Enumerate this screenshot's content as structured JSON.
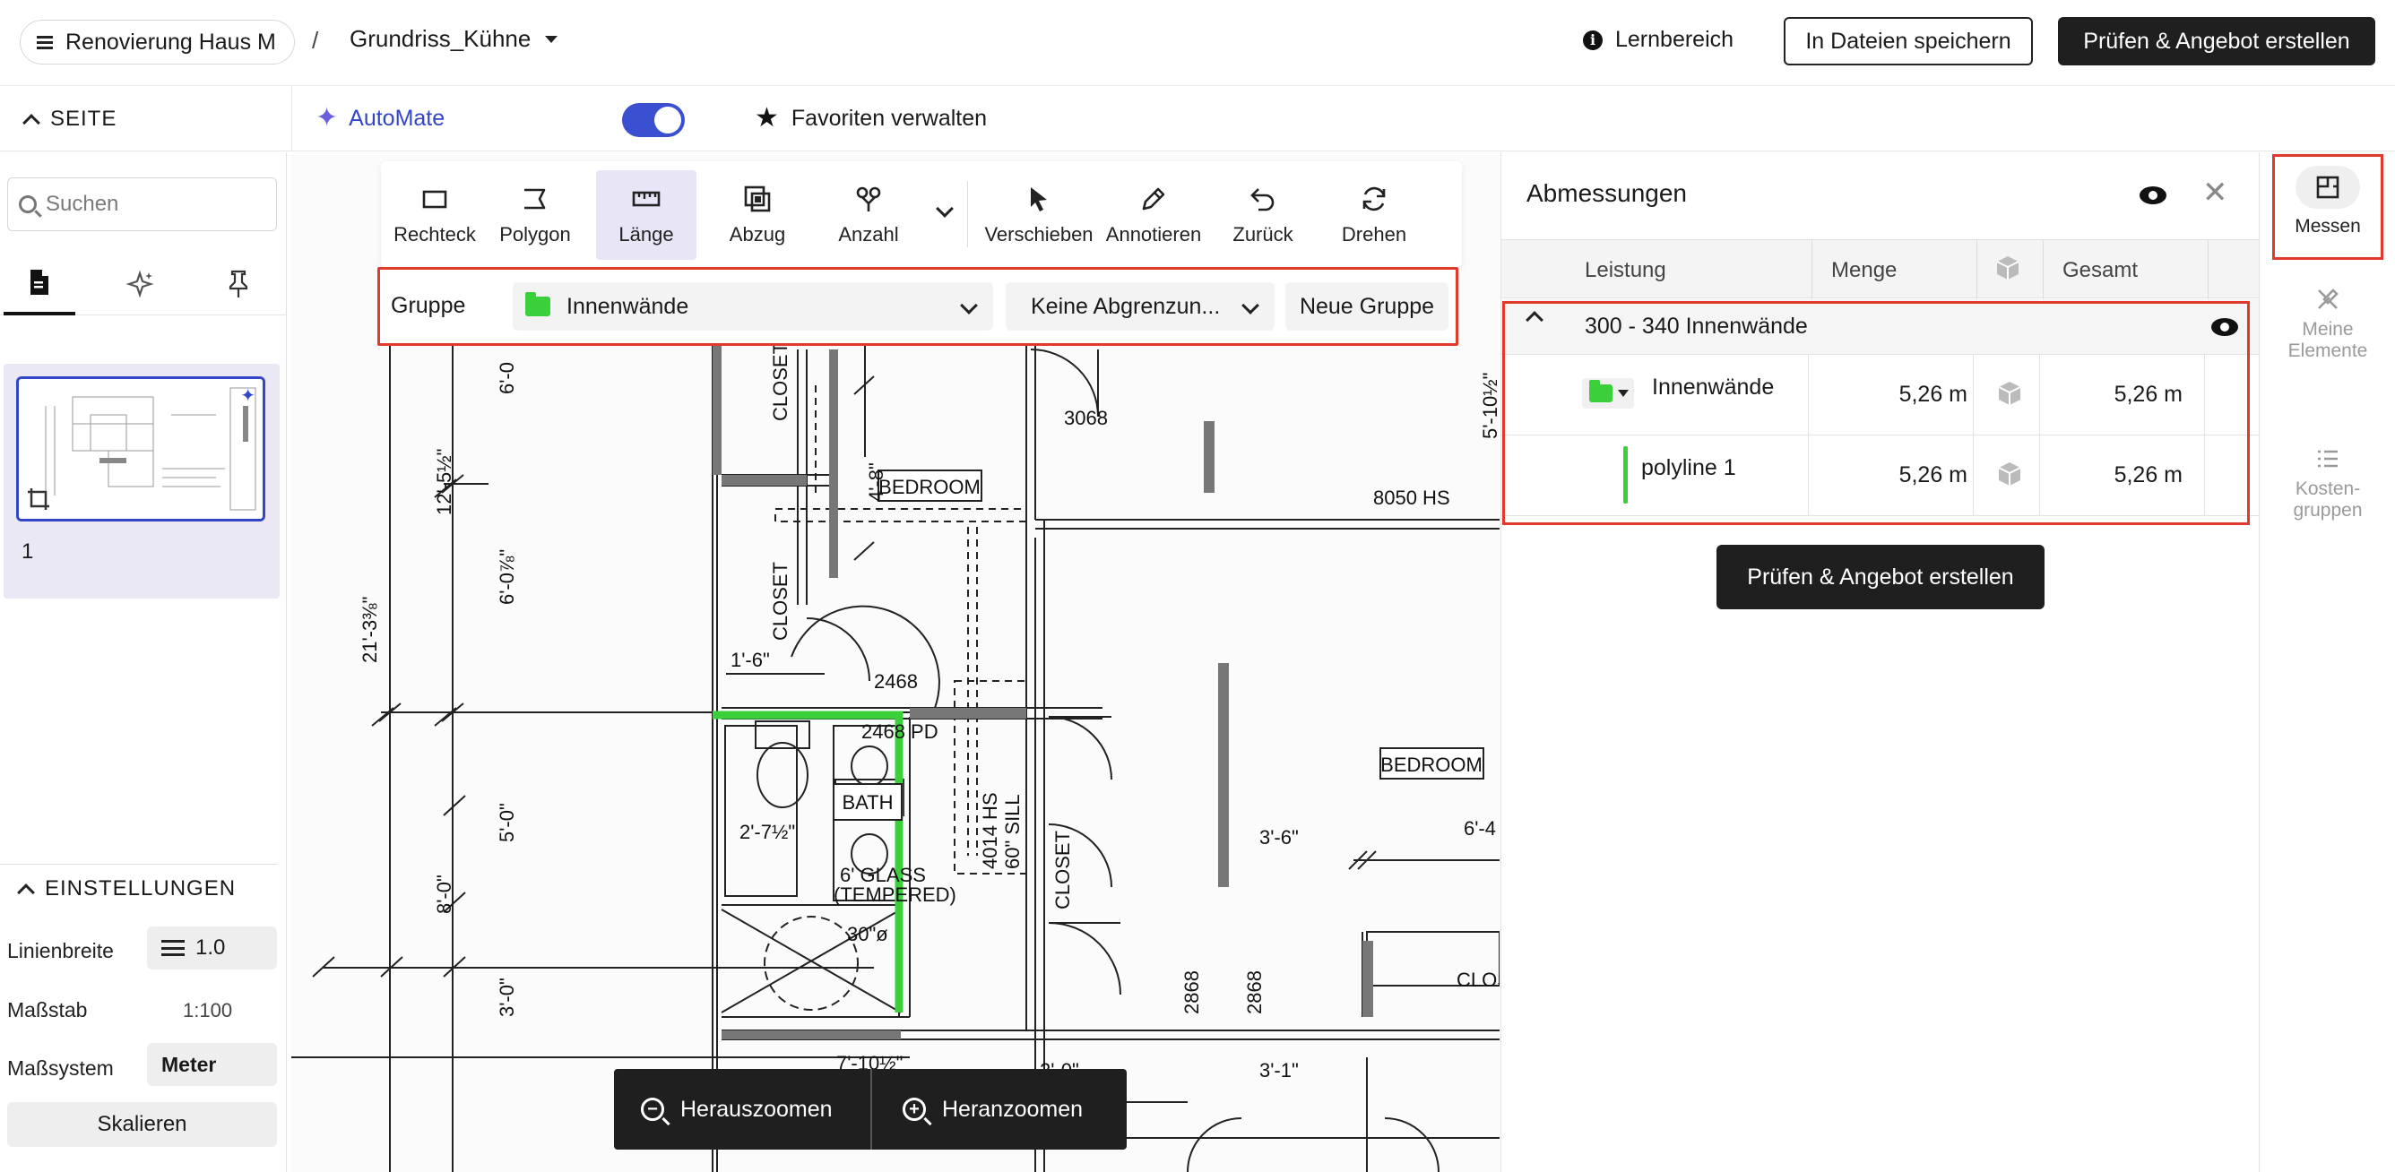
{
  "topbar": {
    "project": "Renovierung Haus M",
    "separator": "/",
    "file": "Grundriss_Kühne",
    "learn": "Lernbereich",
    "save": "In Dateien speichern",
    "check": "Prüfen & Angebot erstellen"
  },
  "subbar": {
    "seite": "SEITE",
    "automate": "AutoMate",
    "automate_on": true,
    "favorites": "Favoriten verwalten"
  },
  "sidebar": {
    "search_placeholder": "Suchen",
    "page_number": "1",
    "settings_title": "EINSTELLUNGEN",
    "line_width_label": "Linienbreite",
    "line_width": "1.0",
    "scale_label": "Maßstab",
    "scale": "1:100",
    "unit_label": "Maßsystem",
    "unit": "Meter",
    "scale_button": "Skalieren"
  },
  "toolbar": {
    "tools": [
      {
        "label": "Rechteck",
        "icon": "rectangle-icon"
      },
      {
        "label": "Polygon",
        "icon": "polygon-icon"
      },
      {
        "label": "Länge",
        "icon": "ruler-icon",
        "active": true
      },
      {
        "label": "Abzug",
        "icon": "subtract-icon"
      },
      {
        "label": "Anzahl",
        "icon": "count-icon"
      },
      {
        "label": "Verschieben",
        "icon": "cursor-icon"
      },
      {
        "label": "Annotieren",
        "icon": "pen-icon"
      },
      {
        "label": "Zurück",
        "icon": "undo-icon"
      },
      {
        "label": "Drehen",
        "icon": "rotate-icon"
      }
    ]
  },
  "grouprow": {
    "label": "Gruppe",
    "group": "Innenwände",
    "boundary": "Keine Abgrenzun...",
    "new_group": "Neue Gruppe"
  },
  "zoom": {
    "out": "Herauszoomen",
    "in": "Heranzoomen"
  },
  "plan": {
    "labels": [
      "BEDROOM",
      "BEDROOM",
      "BATH",
      "CLOSET",
      "CLOSET",
      "CLOSET",
      "CLOS",
      "3068",
      "2468",
      "2468 PD",
      "8050 HS",
      "2868",
      "2868",
      "4014 HS",
      "60\" SILL",
      "6' GLASS",
      "(TEMPERED)",
      "30\"ø",
      "1'-6\"",
      "4'-8\"",
      "3'-6\"",
      "6'-4",
      "3'-1\"",
      "7'-10½\"",
      "2'-7½\"",
      "12'-5½\"",
      "6'-0⅞\"",
      "21'-3⅜\"",
      "5'-0\"",
      "8'-0\"",
      "3'-0\"",
      "6'-0",
      "5'-10½\"",
      "2'-0\""
    ]
  },
  "panel": {
    "title": "Abmessungen",
    "columns": [
      "Leistung",
      "Menge",
      "",
      "Gesamt"
    ],
    "group_row": "300 - 340 Innenwände",
    "rows": [
      {
        "name": "Innenwände",
        "menge": "5,26 m",
        "gesamt": "5,26 m"
      },
      {
        "name": "polyline 1",
        "menge": "5,26 m",
        "gesamt": "5,26 m"
      }
    ],
    "cta": "Prüfen & Angebot erstellen"
  },
  "rail": {
    "measure": "Messen",
    "my_elements": "Meine Elemente",
    "cost_groups": "Kosten-gruppen"
  },
  "colors": {
    "accent": "#3346c8",
    "highlight": "#e03a2c",
    "measure_line": "#3ccf3c",
    "dark_button": "#1f1f1f"
  }
}
